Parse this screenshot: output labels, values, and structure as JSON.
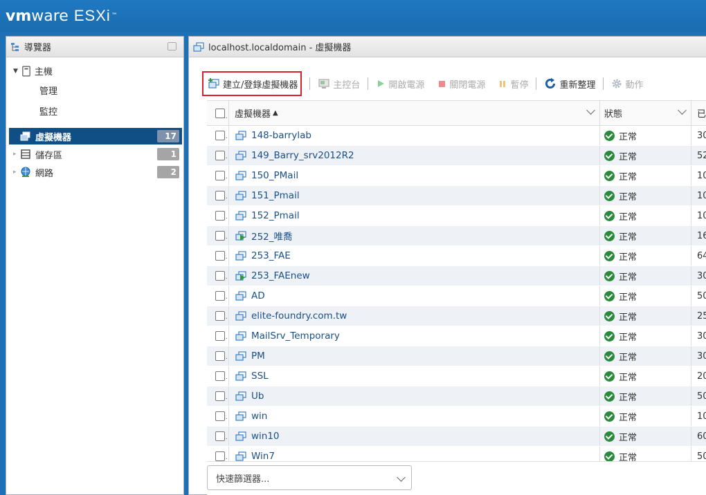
{
  "header": {
    "logo_vm": "vm",
    "logo_ware": "ware",
    "logo_product": "ESXi",
    "logo_tm": "™",
    "brand_color": "#1e70b6"
  },
  "navigator": {
    "title": "導覽器",
    "host": {
      "label": "主機",
      "icon": "server-icon",
      "children": [
        "管理",
        "監控"
      ]
    },
    "items": [
      {
        "label": "虛擬機器",
        "badge": "17",
        "icon": "vm-icon",
        "active": true
      },
      {
        "label": "儲存區",
        "badge": "1",
        "icon": "storage-icon",
        "active": false
      },
      {
        "label": "網路",
        "badge": "2",
        "icon": "network-icon",
        "active": false
      }
    ]
  },
  "main": {
    "title": "localhost.localdomain - 虛擬機器",
    "toolbar": {
      "create": "建立/登錄虛擬機器",
      "console": "主控台",
      "power_on": "開啟電源",
      "power_off": "關閉電源",
      "suspend": "暫停",
      "refresh": "重新整理",
      "actions": "動作"
    },
    "table": {
      "col_name": "虛擬機器",
      "col_name_sort": "▲",
      "col_state": "狀態",
      "col_extra": "已",
      "rows": [
        {
          "name": "148-barrylab",
          "state": "正常",
          "extra": "30",
          "powered": false
        },
        {
          "name": "149_Barry_srv2012R2",
          "state": "正常",
          "extra": "52",
          "powered": false
        },
        {
          "name": "150_PMail",
          "state": "正常",
          "extra": "10",
          "powered": false
        },
        {
          "name": "151_Pmail",
          "state": "正常",
          "extra": "10",
          "powered": false
        },
        {
          "name": "152_Pmail",
          "state": "正常",
          "extra": "10",
          "powered": false
        },
        {
          "name": "252_唯喬",
          "state": "正常",
          "extra": "16",
          "powered": true
        },
        {
          "name": "253_FAE",
          "state": "正常",
          "extra": "64",
          "powered": false
        },
        {
          "name": "253_FAEnew",
          "state": "正常",
          "extra": "30",
          "powered": true
        },
        {
          "name": "AD",
          "state": "正常",
          "extra": "50",
          "powered": false
        },
        {
          "name": "elite-foundry.com.tw",
          "state": "正常",
          "extra": "25",
          "powered": false
        },
        {
          "name": "MailSrv_Temporary",
          "state": "正常",
          "extra": "30",
          "powered": false
        },
        {
          "name": "PM",
          "state": "正常",
          "extra": "30",
          "powered": false
        },
        {
          "name": "SSL",
          "state": "正常",
          "extra": "20",
          "powered": false
        },
        {
          "name": "Ub",
          "state": "正常",
          "extra": "50",
          "powered": false
        },
        {
          "name": "win",
          "state": "正常",
          "extra": "10",
          "powered": false
        },
        {
          "name": "win10",
          "state": "正常",
          "extra": "60",
          "powered": false
        },
        {
          "name": "Win7",
          "state": "正常",
          "extra": "50",
          "powered": false
        }
      ]
    },
    "filter_placeholder": "快速篩選器..."
  }
}
